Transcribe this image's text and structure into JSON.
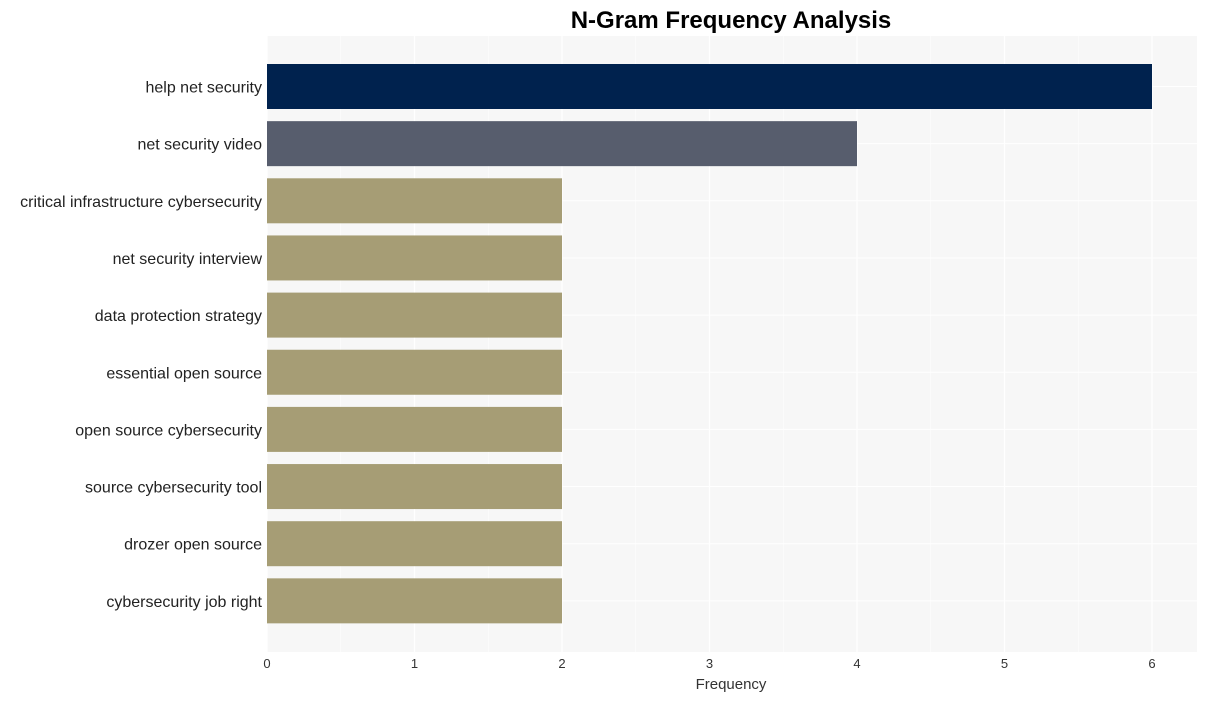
{
  "chart_data": {
    "type": "bar",
    "orientation": "horizontal",
    "title": "N-Gram Frequency Analysis",
    "xlabel": "Frequency",
    "ylabel": "",
    "xlim": [
      0,
      6.3
    ],
    "xticks": [
      0,
      1,
      2,
      3,
      4,
      5,
      6
    ],
    "grid": true,
    "categories": [
      "help net security",
      "net security video",
      "critical infrastructure cybersecurity",
      "net security interview",
      "data protection strategy",
      "essential open source",
      "open source cybersecurity",
      "source cybersecurity tool",
      "drozer open source",
      "cybersecurity job right"
    ],
    "values": [
      6,
      4,
      2,
      2,
      2,
      2,
      2,
      2,
      2,
      2
    ],
    "bar_colors": [
      "#00224e",
      "#575d6d",
      "#a69d75",
      "#a69d75",
      "#a69d75",
      "#a69d75",
      "#a69d75",
      "#a69d75",
      "#a69d75",
      "#a69d75"
    ],
    "plot_background": "#f7f7f7",
    "grid_color": "#ffffff"
  }
}
